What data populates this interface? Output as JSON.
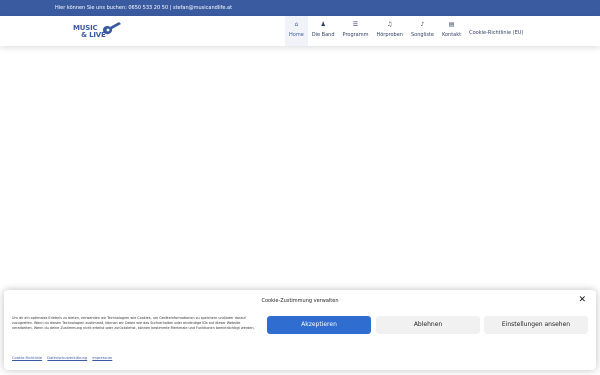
{
  "topbar": {
    "text": "Hier können Sie uns buchen: 0650 533 20 50 | stefan@musicandlife.at"
  },
  "logo": {
    "line1": "MUSIC",
    "line2": "& LIVE"
  },
  "nav": [
    {
      "label": "Home",
      "icon": "home-icon",
      "glyph": "⌂"
    },
    {
      "label": "Die Band",
      "icon": "users-icon",
      "glyph": "♟"
    },
    {
      "label": "Programm",
      "icon": "list-icon",
      "glyph": "☰"
    },
    {
      "label": "Hörproben",
      "icon": "headphones-icon",
      "glyph": "♫"
    },
    {
      "label": "Songliste",
      "icon": "guitar-icon",
      "glyph": "♪"
    },
    {
      "label": "Kontakt",
      "icon": "address-book-icon",
      "glyph": "▤"
    },
    {
      "label": "Cookie-Richtlinie (EU)"
    }
  ],
  "cookie": {
    "title": "Cookie-Zustimmung verwalten",
    "close_glyph": "✕",
    "text": "Um dir ein optimales Erlebnis zu bieten, verwenden wir Technologien wie Cookies, um Geräteinformationen zu speichern und/oder darauf zuzugreifen. Wenn du diesen Technologien zustimmst, können wir Daten wie das Surfverhalten oder eindeutige IDs auf dieser Website verarbeiten. Wenn du deine Zustimmung nicht erteilst oder zurückziehst, können bestimmte Merkmale und Funktionen beeinträchtigt werden.",
    "accept": "Akzeptieren",
    "deny": "Ablehnen",
    "settings": "Einstellungen ansehen",
    "links": [
      "Cookie-Richtlinie",
      "Datenschutzerklärung",
      "Impressum"
    ]
  },
  "colors": {
    "brand": "#3b5ba1",
    "accept": "#2f6ed0"
  }
}
